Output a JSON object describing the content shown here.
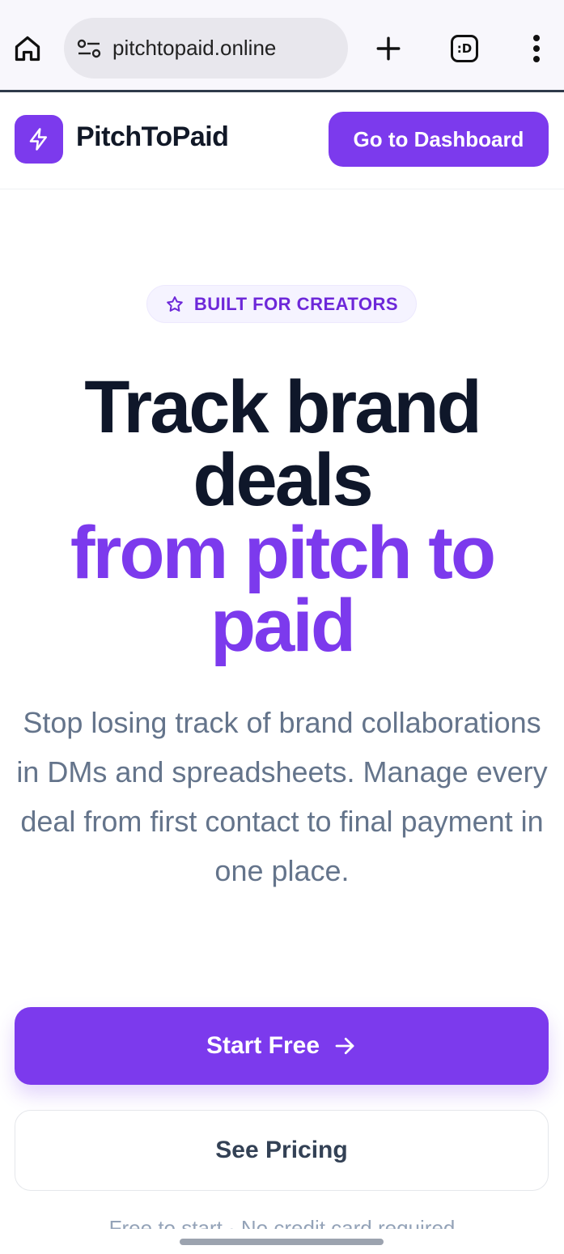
{
  "browser": {
    "url": "pitchtopaid.online",
    "tabs_label": ":D"
  },
  "header": {
    "brand": "PitchToPaid",
    "dashboard_button": "Go to Dashboard"
  },
  "hero": {
    "badge": "BUILT FOR CREATORS",
    "title_line1": "Track brand deals",
    "title_line2": "from pitch to paid",
    "description": "Stop losing track of brand collaborations in DMs and spreadsheets. Manage every deal from first contact to final payment in one place.",
    "start_button": "Start Free",
    "pricing_button": "See Pricing",
    "footnote": "Free to start · No credit card required"
  },
  "colors": {
    "accent": "#7c3aed",
    "heading": "#0f172a",
    "body_text": "#64748b"
  },
  "icons": {
    "home": "home-icon",
    "site_settings": "tune-icon",
    "new_tab": "plus-icon",
    "tab_switcher": "tabs-icon",
    "menu": "more-vert-icon",
    "logo": "lightning-icon",
    "badge": "star-icon",
    "start_arrow": "arrow-right-icon"
  }
}
